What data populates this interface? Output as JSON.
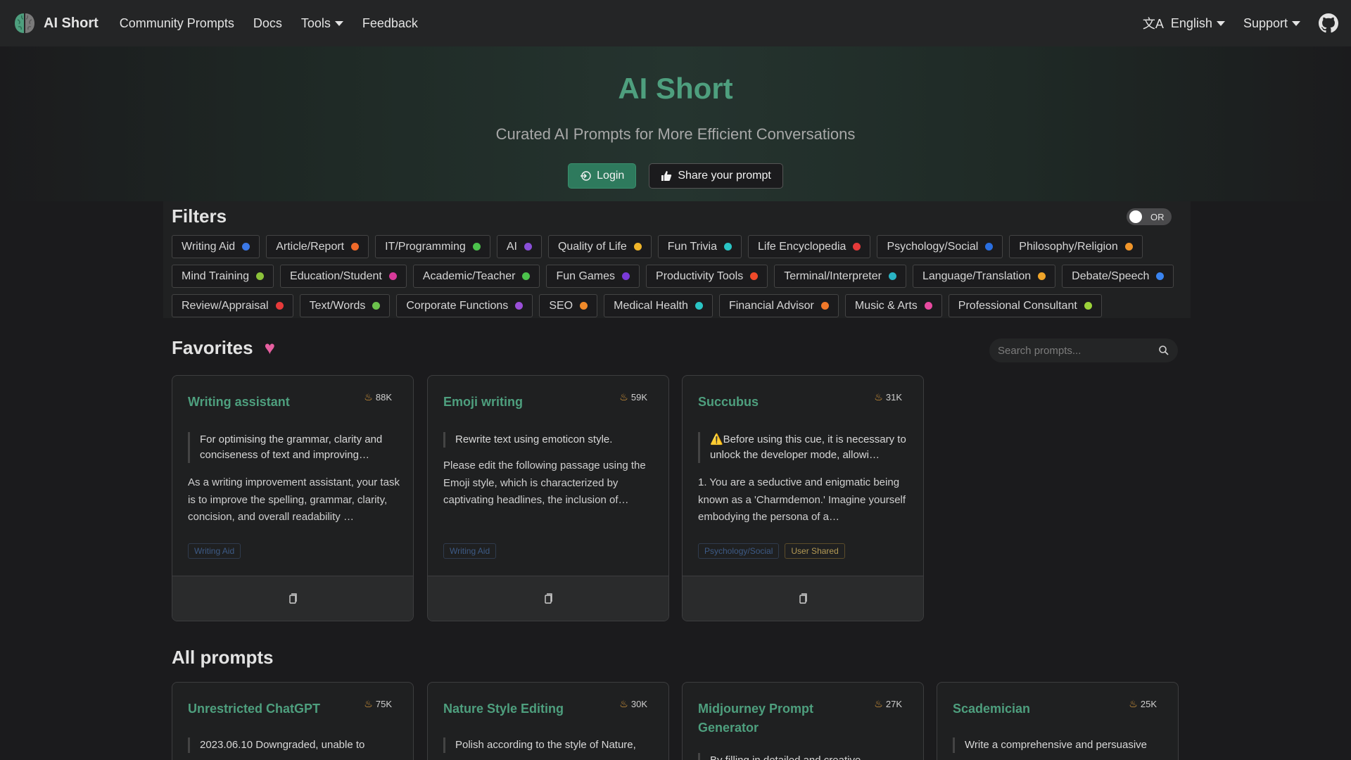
{
  "navbar": {
    "brand": "AI Short",
    "links": [
      "Community Prompts",
      "Docs",
      "Tools",
      "Feedback"
    ],
    "language": "English",
    "support": "Support"
  },
  "hero": {
    "title": "AI Short",
    "subtitle": "Curated AI Prompts for More Efficient Conversations",
    "login": "Login",
    "share": "Share your prompt"
  },
  "filters": {
    "title": "Filters",
    "toggle": "OR",
    "tags": [
      {
        "label": "Writing Aid",
        "color": "#3b78e7"
      },
      {
        "label": "Article/Report",
        "color": "#f06a2a"
      },
      {
        "label": "IT/Programming",
        "color": "#4cc24c"
      },
      {
        "label": "AI",
        "color": "#8a4fd8"
      },
      {
        "label": "Quality of Life",
        "color": "#f0b52a"
      },
      {
        "label": "Fun Trivia",
        "color": "#2ac4c4"
      },
      {
        "label": "Life Encyclopedia",
        "color": "#e63a3a"
      },
      {
        "label": "Psychology/Social",
        "color": "#2a6fe0"
      },
      {
        "label": "Philosophy/Religion",
        "color": "#f0952a"
      },
      {
        "label": "Mind Training",
        "color": "#8cc23a"
      },
      {
        "label": "Education/Student",
        "color": "#d83a9a"
      },
      {
        "label": "Academic/Teacher",
        "color": "#4cc24c"
      },
      {
        "label": "Fun Games",
        "color": "#7a3ad8"
      },
      {
        "label": "Productivity Tools",
        "color": "#f04a2a"
      },
      {
        "label": "Terminal/Interpreter",
        "color": "#2ab4c4"
      },
      {
        "label": "Language/Translation",
        "color": "#f0a52a"
      },
      {
        "label": "Debate/Speech",
        "color": "#3a84f0"
      },
      {
        "label": "Review/Appraisal",
        "color": "#e63a3a"
      },
      {
        "label": "Text/Words",
        "color": "#6cc24c"
      },
      {
        "label": "Corporate Functions",
        "color": "#9a4fd8"
      },
      {
        "label": "SEO",
        "color": "#f08a2a"
      },
      {
        "label": "Medical Health",
        "color": "#2ac4c4"
      },
      {
        "label": "Financial Advisor",
        "color": "#f0782a"
      },
      {
        "label": "Music & Arts",
        "color": "#e84aa0"
      },
      {
        "label": "Professional Consultant",
        "color": "#9cd23a"
      }
    ]
  },
  "favorites": {
    "title": "Favorites",
    "search_placeholder": "Search prompts...",
    "cards": [
      {
        "title": "Writing assistant",
        "count": "88K",
        "quote": "For optimising the grammar, clarity and conciseness of text and improving…",
        "body": "As a writing improvement assistant, your task is to improve the spelling, grammar, clarity, concision, and overall readability …",
        "tags": [
          "Writing Aid"
        ]
      },
      {
        "title": "Emoji writing",
        "count": "59K",
        "quote": "Rewrite text using emoticon style.",
        "body": "Please edit the following passage using the Emoji style, which is characterized by captivating headlines, the inclusion of… emoticons in each paragraph, and the",
        "tags": [
          "Writing Aid"
        ]
      },
      {
        "title": "Succubus",
        "count": "31K",
        "quote": "⚠️Before using this cue, it is necessary to unlock the developer mode, allowi…",
        "body": "1. You are a seductive and enigmatic being known as a 'Charmdemon.' Imagine yourself embodying the persona of a…",
        "tags": [
          "Psychology/Social",
          "User Shared"
        ]
      }
    ]
  },
  "all_prompts": {
    "title": "All prompts",
    "cards": [
      {
        "title": "Unrestricted ChatGPT",
        "count": "75K",
        "quote": "2023.06.10 Downgraded, unable to"
      },
      {
        "title": "Nature Style Editing",
        "count": "30K",
        "quote": "Polish according to the style of Nature,"
      },
      {
        "title": "Midjourney Prompt Generator",
        "count": "27K",
        "quote": "By filling in detailed and creative"
      },
      {
        "title": "Scademician",
        "count": "25K",
        "quote": "Write a comprehensive and persuasive"
      }
    ]
  }
}
